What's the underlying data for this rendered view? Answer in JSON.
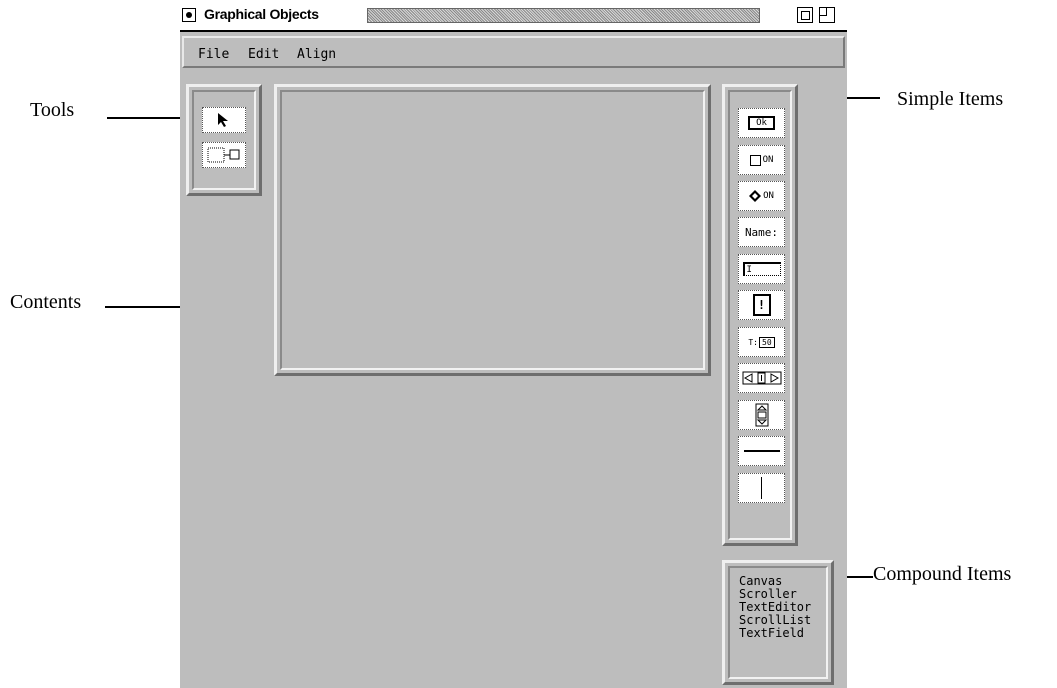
{
  "window": {
    "title": "Graphical Objects",
    "close_icon": "close-box-icon",
    "zoom_icon": "zoom-box-icon",
    "collapse_icon": "collapse-box-icon"
  },
  "menubar": {
    "items": [
      {
        "label": "File"
      },
      {
        "label": "Edit"
      },
      {
        "label": "Align"
      }
    ]
  },
  "tools": {
    "items": [
      {
        "icon": "arrow-pointer-icon"
      },
      {
        "icon": "connect-tool-icon"
      }
    ]
  },
  "simple_items": [
    {
      "icon": "button-item-icon",
      "label": "Ok"
    },
    {
      "icon": "checkbox-item-icon",
      "label": "ON"
    },
    {
      "icon": "radio-item-icon",
      "label": "ON"
    },
    {
      "icon": "label-item-icon",
      "label": "Name:"
    },
    {
      "icon": "textfield-item-icon",
      "label": "I"
    },
    {
      "icon": "alert-item-icon",
      "label": "!"
    },
    {
      "icon": "numeric-field-icon",
      "label": "T:",
      "value": "50"
    },
    {
      "icon": "horizontal-slider-icon"
    },
    {
      "icon": "vertical-slider-icon"
    },
    {
      "icon": "horizontal-line-icon"
    },
    {
      "icon": "vertical-line-icon"
    }
  ],
  "compound_items": [
    "Canvas",
    "Scroller",
    "TextEditor",
    "ScrollList",
    "TextField"
  ],
  "annotations": {
    "tools": "Tools",
    "contents": "Contents",
    "simple_items": "Simple Items",
    "compound_items": "Compound Items"
  }
}
